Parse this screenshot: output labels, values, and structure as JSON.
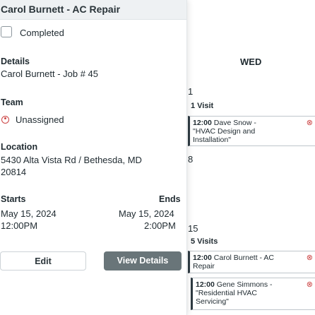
{
  "popover": {
    "title": "Carol Burnett - AC Repair",
    "completed_label": "Completed",
    "details_heading": "Details",
    "job_ref": "Carol Burnett - Job # 45",
    "team_heading": "Team",
    "team_value": "Unassigned",
    "location_heading": "Location",
    "address_line1": "5430 Alta Vista Rd / Bethesda, MD",
    "address_line2": "20814",
    "starts_heading": "Starts",
    "ends_heading": "Ends",
    "start_date": "May 15, 2024",
    "start_time": "12:00PM",
    "end_date": "May 15, 2024",
    "end_time": "2:00PM",
    "edit_label": "Edit",
    "view_details_label": "View Details"
  },
  "calendar": {
    "day_header": "WED",
    "day1": {
      "num": "1",
      "visits": "1 Visit"
    },
    "day2": {
      "num": "8"
    },
    "day3": {
      "num": "15",
      "visits": "5 Visits"
    },
    "cards": [
      {
        "time": "12:00",
        "text1": " Dave Snow -",
        "text2": "\"HVAC Design and",
        "text3": "Installation\""
      },
      {
        "time": "12:00",
        "text1": " Carol Burnett - AC",
        "text2": "Repair",
        "text3": ""
      },
      {
        "time": "12:00",
        "text1": " Gene Simmons -",
        "text2": "\"Residential HVAC",
        "text3": "Servicing\""
      }
    ]
  }
}
